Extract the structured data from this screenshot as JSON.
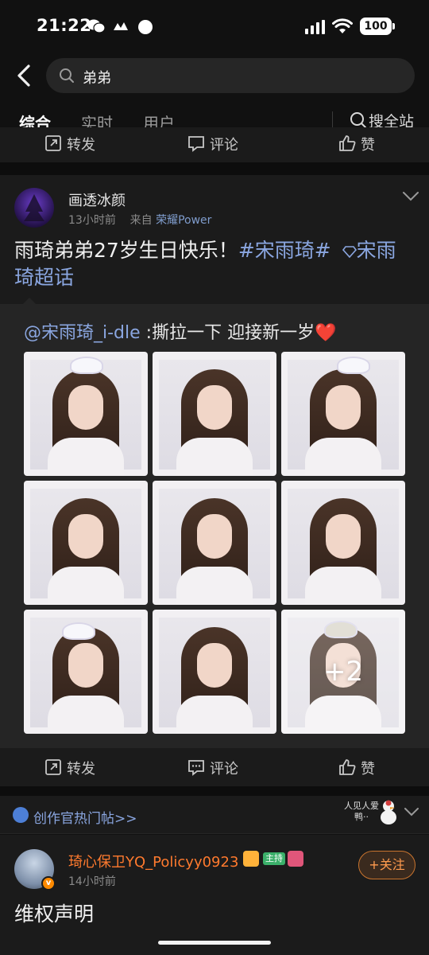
{
  "status_bar": {
    "time": "21:22",
    "battery": "100"
  },
  "search": {
    "query": "弟弟"
  },
  "tabs": [
    {
      "label": "综合",
      "active": true
    },
    {
      "label": "实时",
      "active": false
    },
    {
      "label": "用户",
      "active": false
    }
  ],
  "search_all": "搜全站",
  "actions": {
    "repost": "转发",
    "comment": "评论",
    "like": "赞"
  },
  "post": {
    "author": "画透冰颜",
    "time": "13小时前",
    "source_prefix": "来自",
    "source": "荣耀Power",
    "text_main": "雨琦弟弟27岁生日快乐！",
    "hashtag": "#宋雨琦#",
    "super_topic": "宋雨琦超话",
    "repost": {
      "mention": "@宋雨琦_i-dle",
      "text": " :撕拉一下 迎接新一岁",
      "emoji": "❤️"
    },
    "more_photos": "+2"
  },
  "creator": {
    "label": "创作官热门帖>>",
    "sticker_text": "人见人爱 鸭··"
  },
  "post2": {
    "author": "琦心保卫YQ_Policyy0923",
    "host_badge": "主持",
    "time": "14小时前",
    "follow_label": "+关注",
    "text": "维权声明"
  },
  "colors": {
    "accent": "#ff7a2e",
    "link": "#8aa6e0",
    "background": "#111111",
    "card": "#1b1b1b"
  }
}
